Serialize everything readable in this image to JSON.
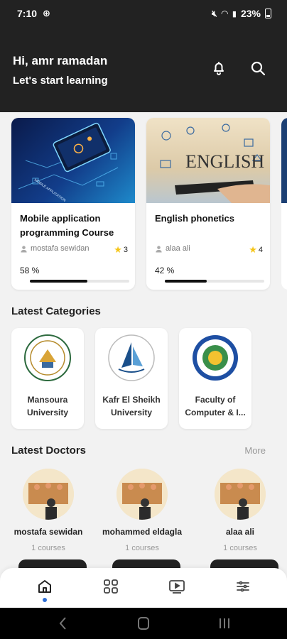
{
  "status_bar": {
    "time": "7:10",
    "battery": "23%"
  },
  "header": {
    "greeting": "Hi, amr ramadan",
    "subtitle": "Let's start learning"
  },
  "courses": [
    {
      "title": "Mobile application programming Course",
      "author": "mostafa sewidan",
      "rating": "3",
      "progress_label": "58 %",
      "progress": 0.58
    },
    {
      "title": "English phonetics",
      "author": "alaa ali",
      "rating": "4",
      "progress_label": "42 %",
      "progress": 0.42
    }
  ],
  "categories_section": {
    "title": "Latest Categories"
  },
  "categories": [
    {
      "name": "Mansoura University"
    },
    {
      "name": "Kafr El Sheikh University"
    },
    {
      "name": "Faculty of Computer & I..."
    }
  ],
  "doctors_section": {
    "title": "Latest Doctors",
    "more_label": "More"
  },
  "doctors": [
    {
      "name": "mostafa sewidan",
      "courses": "1 courses"
    },
    {
      "name": "mohammed eldagla",
      "courses": "1 courses"
    },
    {
      "name": "alaa ali",
      "courses": "1 courses"
    }
  ],
  "nav": {
    "items": [
      "home-icon",
      "grid-icon",
      "video-icon",
      "settings-icon"
    ],
    "active": "home-icon",
    "accent": "#2f6fd6"
  },
  "colors": {
    "header_bg": "#222222",
    "background": "#f2f2f2",
    "star": "#f5c518"
  }
}
